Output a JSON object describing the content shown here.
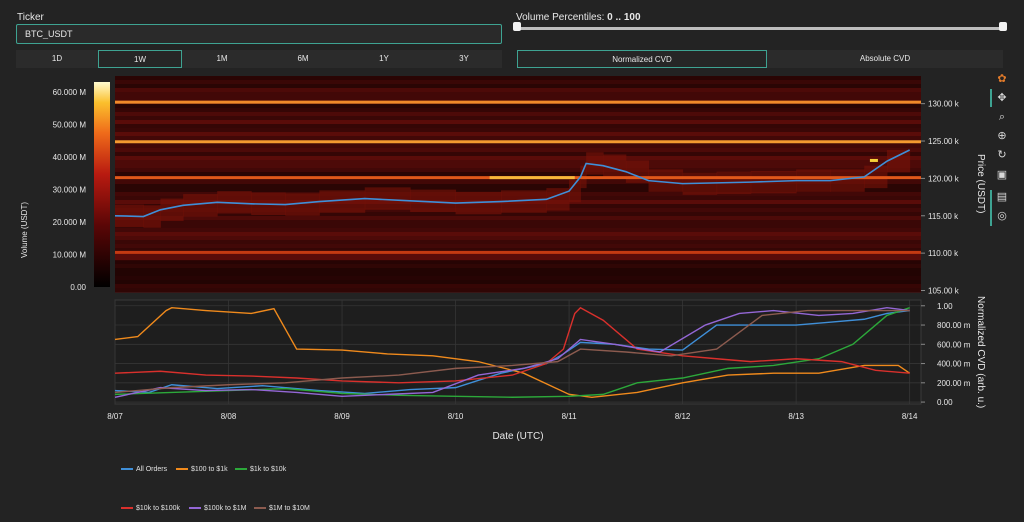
{
  "ticker": {
    "label": "Ticker",
    "value": "BTC_USDT"
  },
  "volume_percentiles": {
    "label": "Volume Percentiles:",
    "value": "0 .. 100",
    "low": 0,
    "high": 100
  },
  "timeframes": {
    "items": [
      "1D",
      "1W",
      "1M",
      "6M",
      "1Y",
      "3Y"
    ],
    "selected": "1W"
  },
  "cvd_modes": {
    "items": [
      "Normalized CVD",
      "Absolute CVD"
    ],
    "selected": "Normalized CVD"
  },
  "modebar_icons": [
    "plotly-logo-icon",
    "pan-icon",
    "zoom-icon",
    "zoom-in-icon",
    "reset-axes-icon",
    "download-icon",
    "hover-compare-icon",
    "spike-lines-icon"
  ],
  "chart_data": [
    {
      "type": "heatmap",
      "title": "",
      "xlabel": "",
      "ylabel": "Price (USDT)",
      "ylim": [
        104800,
        133700
      ],
      "y_ticks": [
        105000,
        110000,
        115000,
        120000,
        125000,
        130000
      ],
      "y_tick_labels": [
        "105.00 k",
        "110.00 k",
        "115.00 k",
        "120.00 k",
        "125.00 k",
        "130.00 k"
      ],
      "colorbar": {
        "title": "Volume (USDT)",
        "range": [
          0,
          63000000
        ],
        "ticks": [
          "0.00",
          "10.000 M",
          "20.000 M",
          "30.000 M",
          "40.000 M",
          "50.000 M",
          "60.000 M"
        ]
      },
      "bright_levels": [
        {
          "price": 130200,
          "volume": 52000000
        },
        {
          "price": 124900,
          "volume": 50000000
        },
        {
          "price": 120100,
          "volume": 34000000
        },
        {
          "price": 110100,
          "volume": 28000000
        }
      ],
      "price_series": {
        "name": "BTC_USDT",
        "color": "#3f8fd8",
        "x": [
          0,
          0.25,
          0.4,
          0.6,
          0.9,
          1.2,
          1.5,
          1.8,
          2.2,
          2.6,
          3.0,
          3.4,
          3.8,
          4.0,
          4.1,
          4.15,
          4.3,
          4.5,
          4.7,
          5.0,
          5.3,
          5.6,
          6.0,
          6.3,
          6.6,
          6.8,
          7.0
        ],
        "y": [
          115000,
          114900,
          115800,
          116400,
          116800,
          116600,
          116500,
          116900,
          117300,
          117000,
          116700,
          116900,
          117200,
          118300,
          120200,
          122000,
          121700,
          120900,
          119700,
          119300,
          119400,
          119500,
          119700,
          119700,
          120200,
          122300,
          123800
        ]
      }
    },
    {
      "type": "line",
      "title": "",
      "xlabel": "Date (UTC)",
      "ylabel": "Normalized CVD (arb. u.)",
      "ylim": [
        -0.02,
        1.06
      ],
      "x_tick_labels": [
        "8/07",
        "8/08",
        "8/09",
        "8/10",
        "8/11",
        "8/12",
        "8/13",
        "8/14"
      ],
      "y_tick_labels": [
        "0.00",
        "200.00 m",
        "400.00 m",
        "600.00 m",
        "800.00 m",
        "1.00"
      ],
      "legend_position": "bottom-left",
      "series": [
        {
          "name": "All Orders",
          "color": "#3f8fd8",
          "x": [
            0,
            0.3,
            0.5,
            0.9,
            1.3,
            1.8,
            2.2,
            2.6,
            3.0,
            3.4,
            3.8,
            3.95,
            4.1,
            4.4,
            4.7,
            5.0,
            5.3,
            5.6,
            6.0,
            6.3,
            6.6,
            6.8,
            7.0
          ],
          "y": [
            0.12,
            0.1,
            0.18,
            0.14,
            0.17,
            0.12,
            0.09,
            0.13,
            0.15,
            0.3,
            0.4,
            0.5,
            0.62,
            0.6,
            0.55,
            0.54,
            0.8,
            0.8,
            0.8,
            0.83,
            0.86,
            0.92,
            0.95
          ]
        },
        {
          "name": "$100 to $1k",
          "color": "#f08a1c",
          "x": [
            0,
            0.2,
            0.45,
            0.5,
            0.8,
            1.2,
            1.4,
            1.6,
            2.0,
            2.4,
            2.8,
            3.2,
            3.6,
            4.0,
            4.2,
            4.6,
            5.0,
            5.4,
            5.8,
            6.2,
            6.6,
            6.9,
            7.0
          ],
          "y": [
            0.65,
            0.68,
            0.95,
            0.98,
            0.95,
            0.92,
            0.97,
            0.55,
            0.54,
            0.5,
            0.48,
            0.42,
            0.3,
            0.08,
            0.05,
            0.1,
            0.2,
            0.28,
            0.3,
            0.3,
            0.38,
            0.38,
            0.3
          ]
        },
        {
          "name": "$1k to $10k",
          "color": "#2ca83a",
          "x": [
            0,
            0.5,
            1.0,
            1.5,
            2.0,
            2.5,
            3.0,
            3.5,
            4.0,
            4.3,
            4.6,
            5.0,
            5.4,
            5.8,
            6.2,
            6.5,
            6.8,
            7.0
          ],
          "y": [
            0.08,
            0.1,
            0.12,
            0.14,
            0.09,
            0.07,
            0.06,
            0.05,
            0.06,
            0.08,
            0.2,
            0.25,
            0.35,
            0.38,
            0.45,
            0.6,
            0.9,
            0.98
          ]
        },
        {
          "name": "$10k to $100k",
          "color": "#d9302c",
          "x": [
            0,
            0.4,
            0.8,
            1.2,
            1.6,
            2.0,
            2.5,
            3.0,
            3.5,
            3.8,
            3.95,
            4.05,
            4.1,
            4.3,
            4.6,
            5.0,
            5.3,
            5.6,
            6.0,
            6.4,
            6.7,
            7.0
          ],
          "y": [
            0.3,
            0.32,
            0.28,
            0.27,
            0.25,
            0.22,
            0.2,
            0.22,
            0.28,
            0.4,
            0.55,
            0.92,
            0.98,
            0.85,
            0.55,
            0.48,
            0.45,
            0.42,
            0.45,
            0.42,
            0.33,
            0.3
          ]
        },
        {
          "name": "$100k to $1M",
          "color": "#9467d6",
          "x": [
            0,
            0.4,
            0.8,
            1.2,
            1.6,
            2.0,
            2.4,
            2.8,
            3.2,
            3.6,
            3.9,
            4.1,
            4.4,
            4.8,
            5.2,
            5.5,
            5.8,
            6.2,
            6.5,
            6.8,
            7.0
          ],
          "y": [
            0.05,
            0.15,
            0.12,
            0.13,
            0.1,
            0.06,
            0.08,
            0.1,
            0.28,
            0.35,
            0.45,
            0.65,
            0.6,
            0.52,
            0.8,
            0.92,
            0.95,
            0.9,
            0.92,
            0.98,
            0.95
          ]
        },
        {
          "name": "$1M to $10M",
          "color": "#8c5b4f",
          "x": [
            0,
            0.5,
            1.0,
            1.5,
            2.0,
            2.5,
            3.0,
            3.5,
            3.9,
            4.1,
            4.5,
            4.9,
            5.3,
            5.7,
            6.1,
            6.5,
            6.8,
            7.0
          ],
          "y": [
            0.1,
            0.15,
            0.18,
            0.2,
            0.25,
            0.28,
            0.35,
            0.38,
            0.42,
            0.55,
            0.52,
            0.48,
            0.55,
            0.9,
            0.95,
            0.95,
            0.95,
            0.95
          ]
        }
      ]
    }
  ]
}
